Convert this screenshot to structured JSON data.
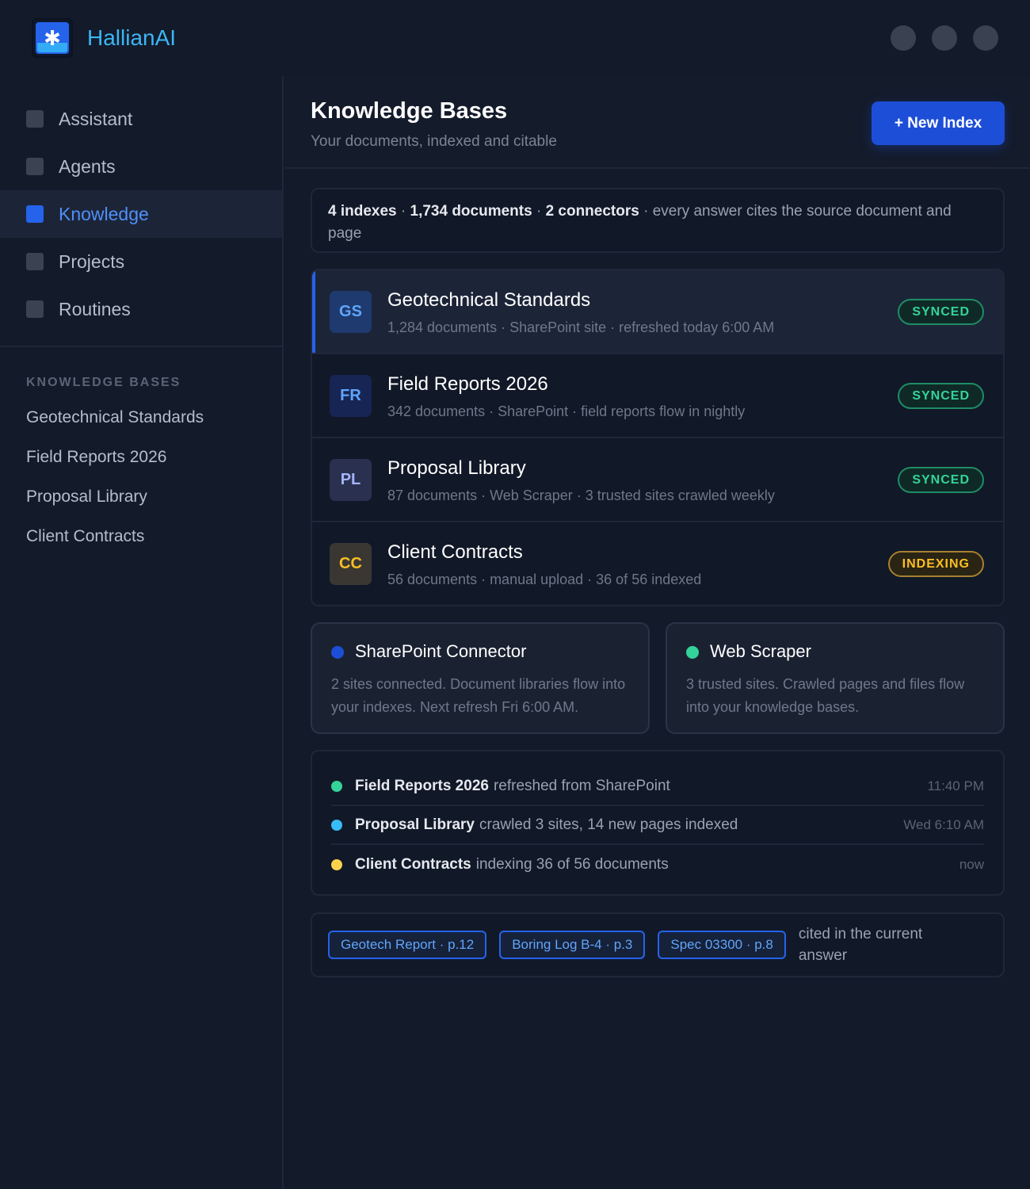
{
  "app": {
    "brand": "HallianAI",
    "logo_icon": "asterisk-icon"
  },
  "nav": {
    "items": [
      {
        "label": "Assistant",
        "active": false
      },
      {
        "label": "Agents",
        "active": false
      },
      {
        "label": "Knowledge",
        "active": true
      },
      {
        "label": "Projects",
        "active": false
      },
      {
        "label": "Routines",
        "active": false
      }
    ]
  },
  "sidebar_kb": {
    "heading": "KNOWLEDGE BASES",
    "links": [
      "Geotechnical Standards",
      "Field Reports 2026",
      "Proposal Library",
      "Client Contracts"
    ]
  },
  "header": {
    "title": "Knowledge Bases",
    "subtitle": "Your documents, indexed and citable",
    "new_button": "+ New Index"
  },
  "summary": {
    "indexes": "4 indexes",
    "documents": "1,734 documents",
    "connectors": "2 connectors",
    "sep": " · ",
    "note": " · every answer cites the source document and page"
  },
  "knowledge_bases": [
    {
      "initials": "GS",
      "name": "Geotechnical Standards",
      "meta": "1,284 documents · SharePoint site · refreshed today 6:00 AM",
      "status": "SYNCED",
      "avatar_bg": "#1e3a6e",
      "avatar_fg": "#60a5fa"
    },
    {
      "initials": "FR",
      "name": "Field Reports 2026",
      "meta": "342 documents · SharePoint · field reports flow in nightly",
      "status": "SYNCED",
      "avatar_bg": "#172554",
      "avatar_fg": "#60a5fa"
    },
    {
      "initials": "PL",
      "name": "Proposal Library",
      "meta": "87 documents · Web Scraper · 3 trusted sites crawled weekly",
      "status": "SYNCED",
      "avatar_bg": "#2a3150",
      "avatar_fg": "#a5b4fc"
    },
    {
      "initials": "CC",
      "name": "Client Contracts",
      "meta": "56 documents · manual upload · 36 of 56 indexed",
      "status": "INDEXING",
      "avatar_bg": "#3a3733",
      "avatar_fg": "#fbbf24"
    }
  ],
  "connectors": [
    {
      "title": "SharePoint Connector",
      "desc": "2 sites connected. Document libraries flow into your indexes. Next refresh Fri 6:00 AM.",
      "dot_color": "#1d4ed8"
    },
    {
      "title": "Web Scraper",
      "desc": "3 trusted sites. Crawled pages and files flow into your knowledge bases.",
      "dot_color": "#34d399"
    }
  ],
  "activity": [
    {
      "subject": "Field Reports 2026",
      "text": "refreshed from SharePoint",
      "time": "11:40 PM",
      "dot_color": "#34d399"
    },
    {
      "subject": "Proposal Library",
      "text": "crawled 3 sites, 14 new pages indexed",
      "time": "Wed 6:10 AM",
      "dot_color": "#38bdf8"
    },
    {
      "subject": "Client Contracts",
      "text": "indexing 36 of 56 documents",
      "time": "now",
      "dot_color": "#fcd34d"
    }
  ],
  "citations": {
    "chips": [
      "Geotech Report · p.12",
      "Boring Log B-4 · p.3",
      "Spec 03300 · p.8"
    ],
    "note": "cited in the current answer"
  }
}
